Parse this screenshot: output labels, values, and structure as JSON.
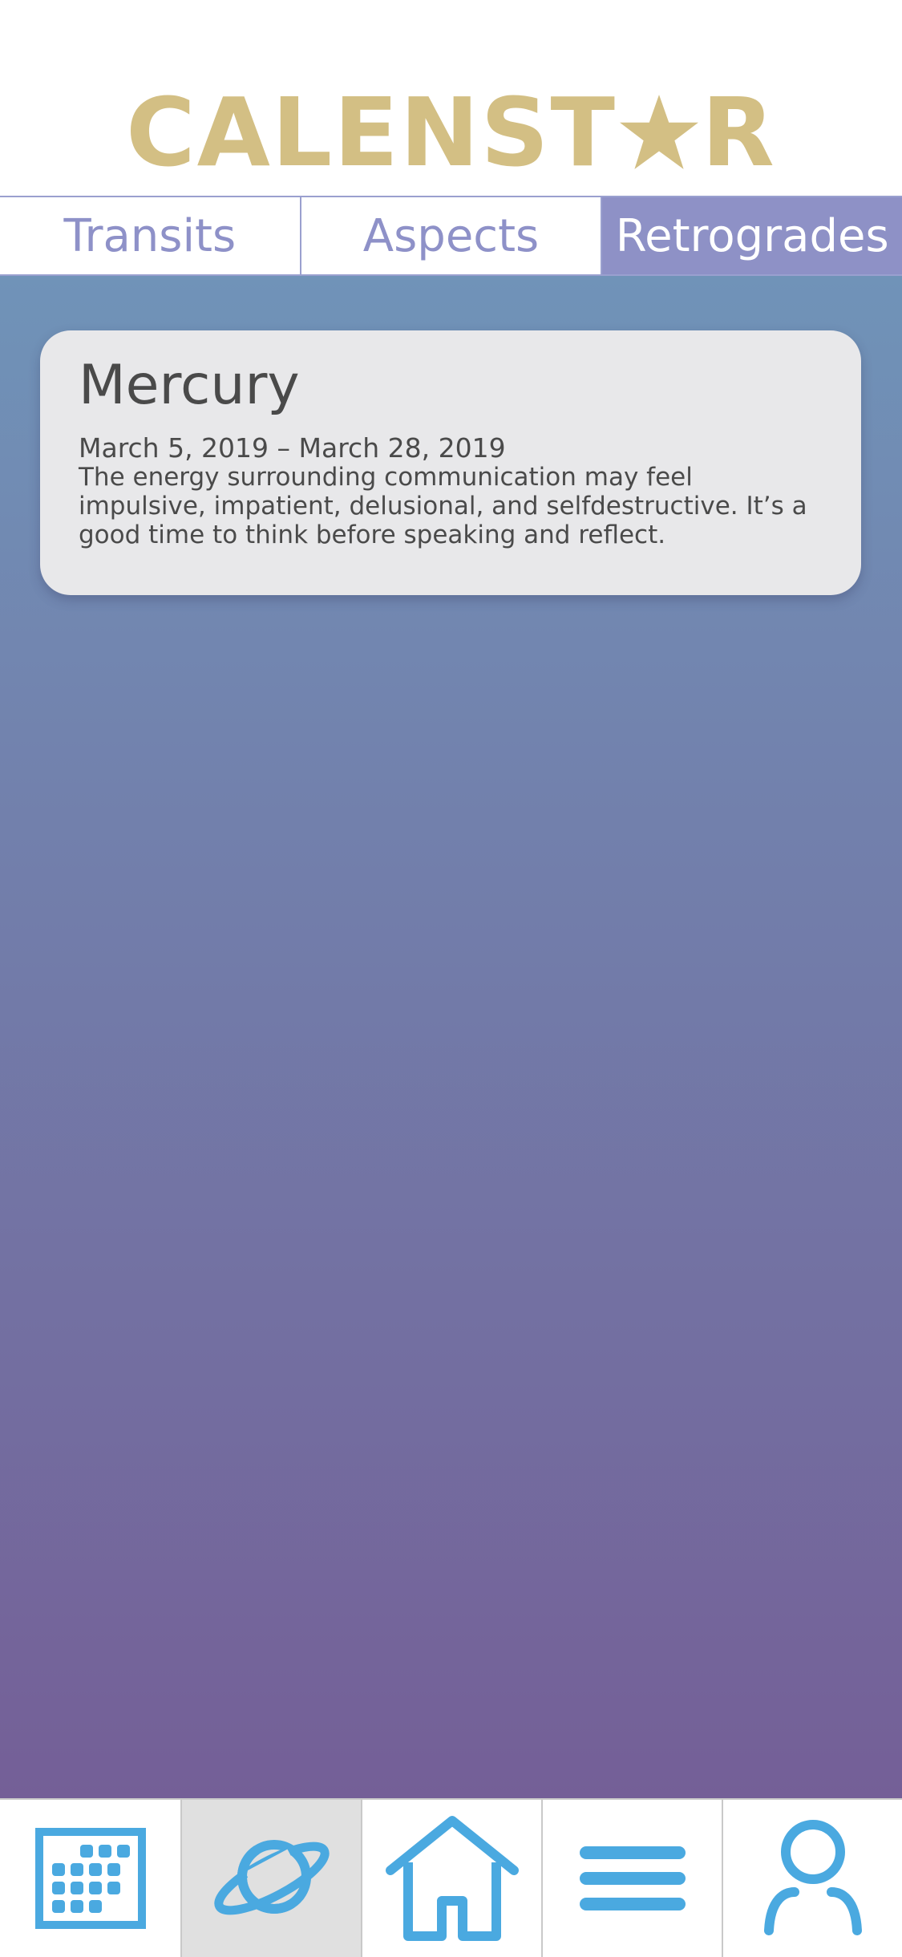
{
  "app": {
    "logo_text_left": "CALENST",
    "logo_text_right": "R",
    "brand_color": "#d3bf84"
  },
  "tabs": [
    {
      "label": "Transits",
      "active": false
    },
    {
      "label": "Aspects",
      "active": false
    },
    {
      "label": "Retrogrades",
      "active": true
    }
  ],
  "retrogrades": [
    {
      "planet": "Mercury",
      "dates": "March 5, 2019 – March 28, 2019",
      "description": "The energy surrounding communication may feel impulsive, impatient, delusional, and selfdestructive. It’s a good time to think before speaking and reflect."
    }
  ],
  "bottom_nav": [
    {
      "icon": "calendar-icon",
      "active": false
    },
    {
      "icon": "planet-icon",
      "active": true
    },
    {
      "icon": "home-icon",
      "active": false
    },
    {
      "icon": "menu-icon",
      "active": false
    },
    {
      "icon": "profile-icon",
      "active": false
    }
  ],
  "colors": {
    "accent": "#4aa9e0",
    "tab_active": "#8e91c6"
  }
}
